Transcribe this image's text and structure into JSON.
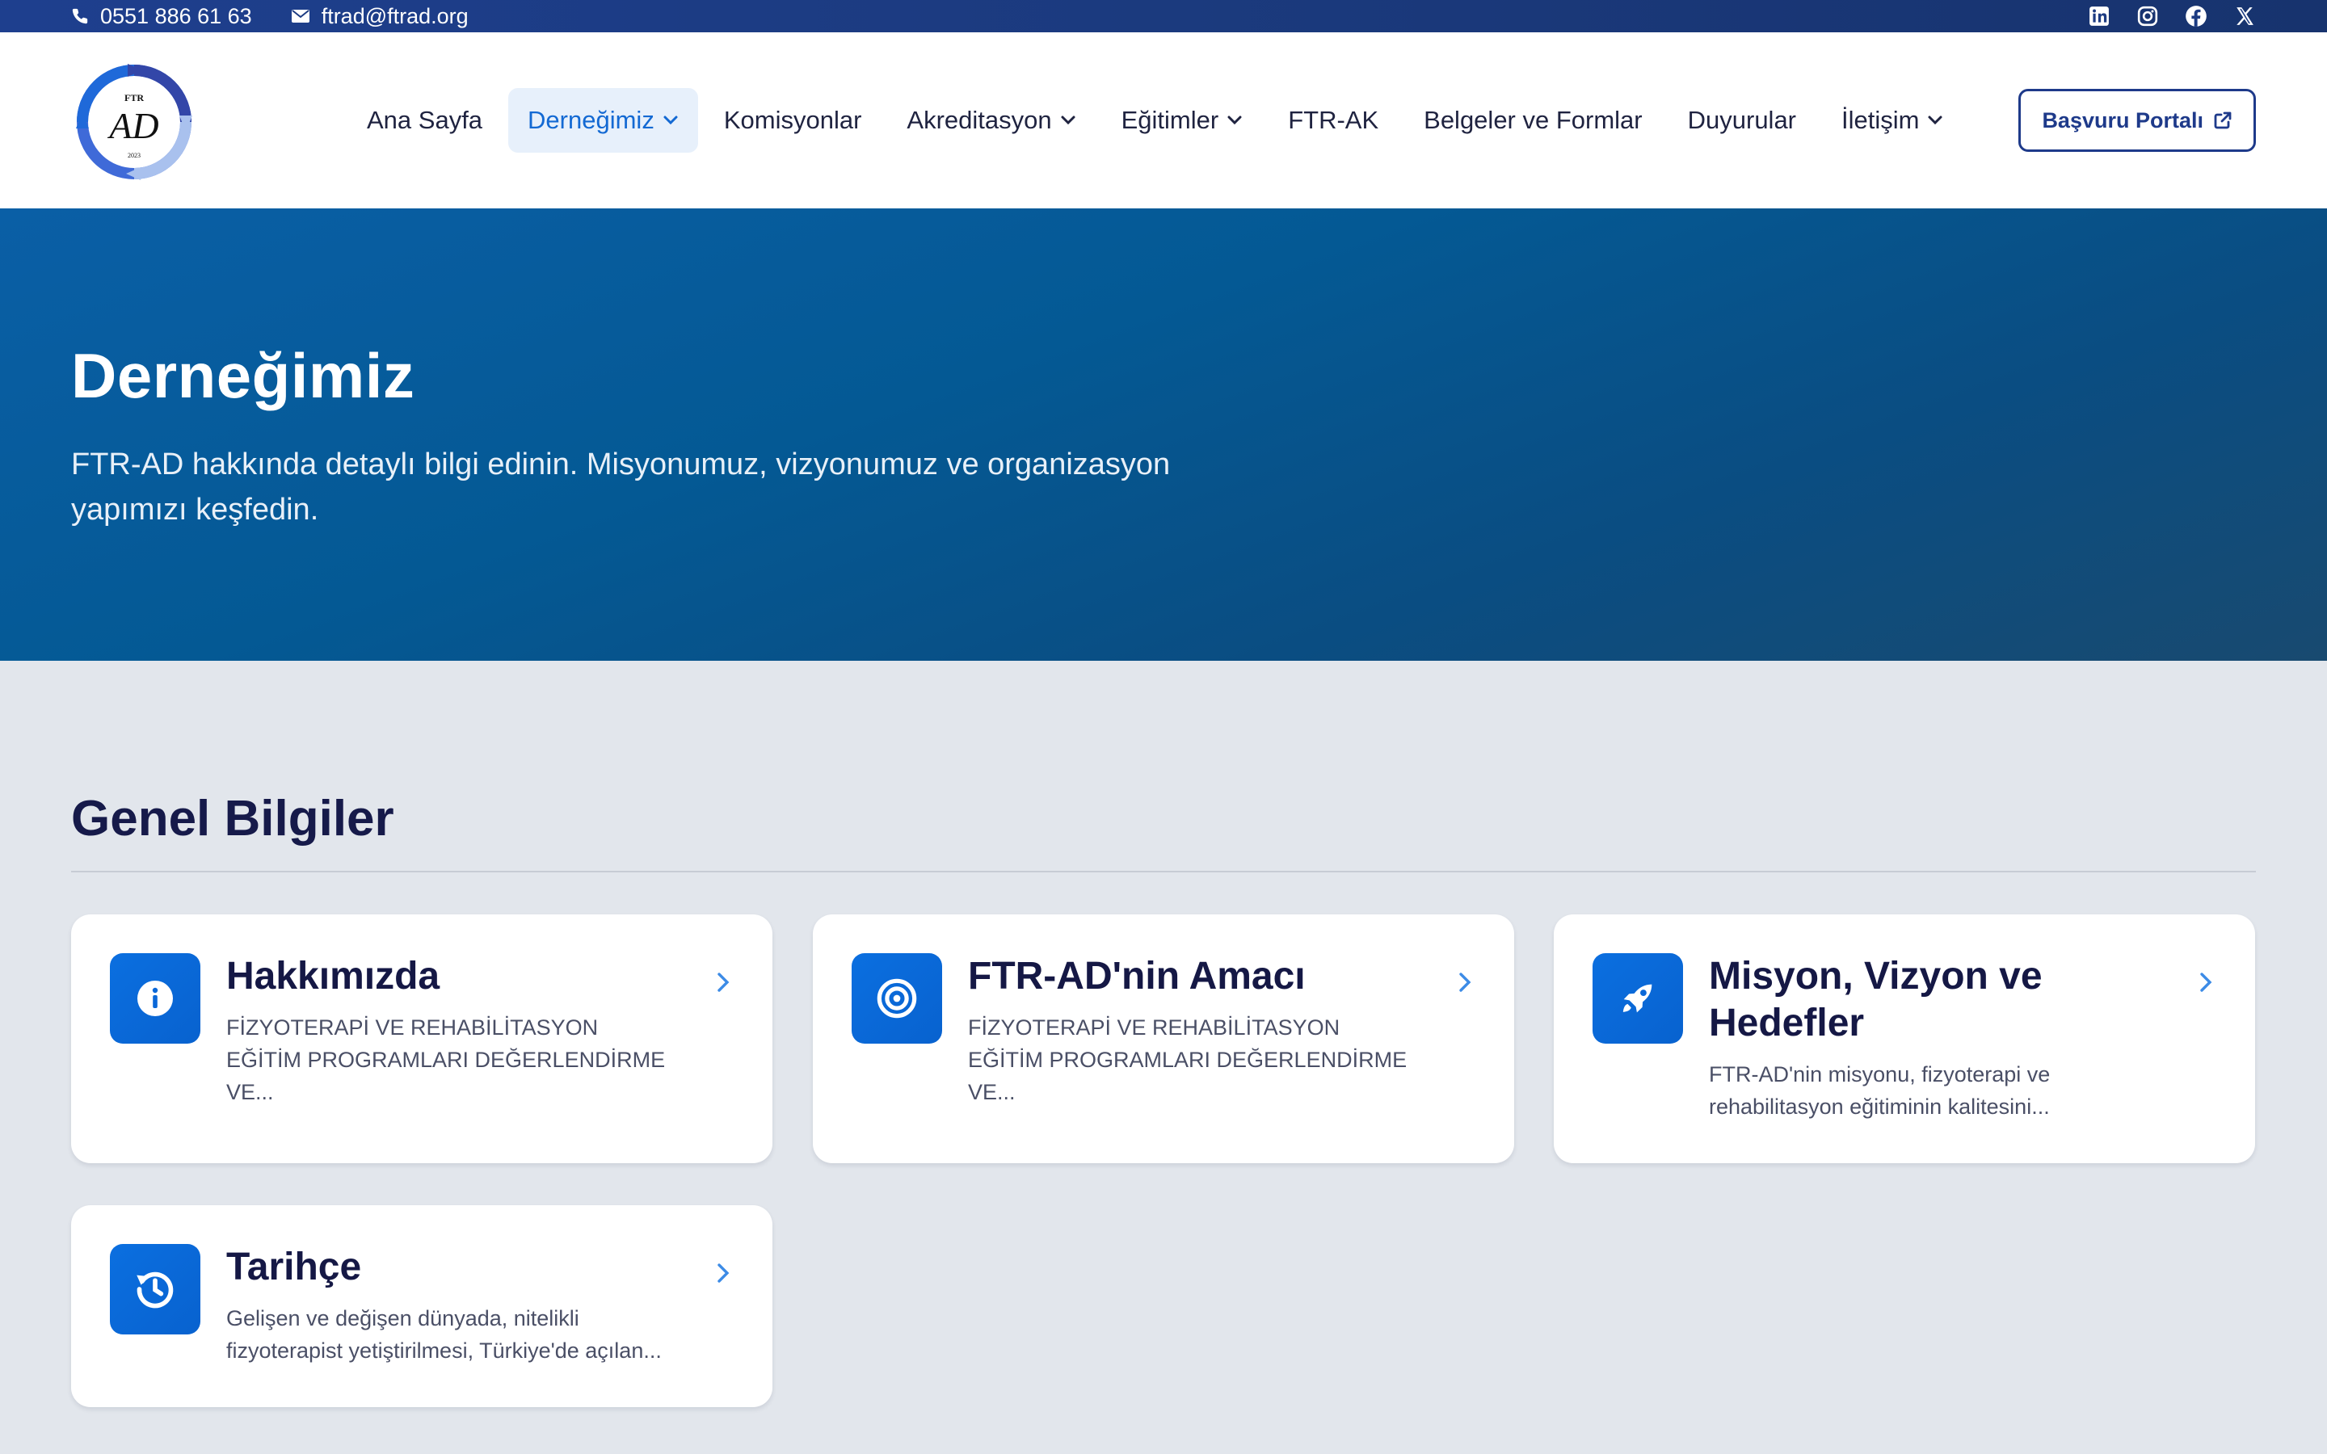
{
  "topbar": {
    "phone": "0551 886 61 63",
    "email": "ftrad@ftrad.org",
    "social": [
      "linkedin-icon",
      "instagram-icon",
      "facebook-icon",
      "x-icon"
    ]
  },
  "logo": {
    "top_text": "FTR",
    "letters": "AD",
    "year": "2023"
  },
  "nav": {
    "items": [
      {
        "label": "Ana Sayfa"
      },
      {
        "label": "Derneğimiz"
      },
      {
        "label": "Komisyonlar"
      },
      {
        "label": "Akreditasyon"
      },
      {
        "label": "Eğitimler"
      },
      {
        "label": "FTR-AK"
      },
      {
        "label": "Belgeler ve Formlar"
      },
      {
        "label": "Duyurular"
      },
      {
        "label": "İletişim"
      }
    ],
    "portal_label": "Başvuru Portalı"
  },
  "hero": {
    "title": "Derneğimiz",
    "subtitle": "FTR-AD hakkında detaylı bilgi edinin. Misyonumuz, vizyonumuz ve organizasyon yapımızı keşfedin."
  },
  "section": {
    "title": "Genel Bilgiler",
    "cards": [
      {
        "title": "Hakkımızda",
        "desc": "FİZYOTERAPİ VE REHABİLİTASYON EĞİTİM PROGRAMLARI DEĞERLENDİRME VE...",
        "icon": "info-icon"
      },
      {
        "title": "FTR-AD'nin Amacı",
        "desc": "FİZYOTERAPİ VE REHABİLİTASYON EĞİTİM PROGRAMLARI DEĞERLENDİRME VE...",
        "icon": "target-icon"
      },
      {
        "title": "Misyon, Vizyon ve Hedefler",
        "desc": "FTR-AD'nin misyonu, fizyoterapi ve rehabilitasyon eğitiminin kalitesini...",
        "icon": "rocket-icon"
      },
      {
        "title": "Tarihçe",
        "desc": "Gelişen ve değişen dünyada, nitelikli fizyoterapist yetiştirilmesi, Türkiye'de açılan...",
        "icon": "history-icon"
      }
    ]
  },
  "colors": {
    "brand": "#1e3a8a",
    "accent": "#0b6fe0",
    "active_nav_bg": "#e7f0fb",
    "active_nav_text": "#1369d3",
    "page_bg": "#e2e6ec"
  }
}
